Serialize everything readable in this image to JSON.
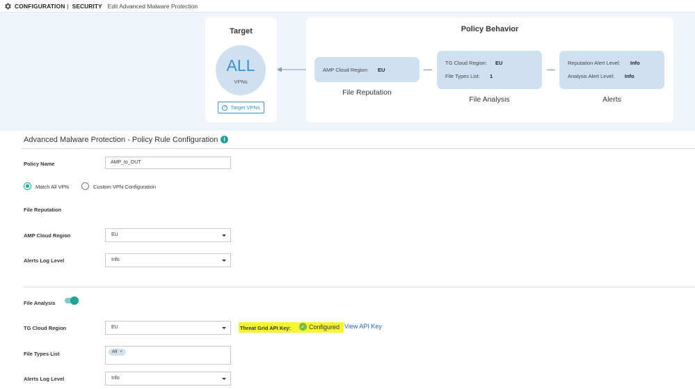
{
  "header": {
    "section": "CONFIGURATION",
    "separator": "|",
    "subsection": "SECURITY",
    "page_title": "Edit Advanced Malware Protection"
  },
  "diagram": {
    "target": {
      "title": "Target",
      "value": "ALL",
      "unit": "VPNs",
      "button_label": "Target VPNs"
    },
    "policy_behavior": {
      "title": "Policy Behavior",
      "file_reputation": {
        "label": "File Reputation",
        "fields": [
          {
            "key": "AMP Cloud Region:",
            "value": "EU"
          }
        ]
      },
      "file_analysis": {
        "label": "File Analysis",
        "fields": [
          {
            "key": "TG Cloud Region:",
            "value": "EU"
          },
          {
            "key": "File Types List:",
            "value": "1"
          }
        ]
      },
      "alerts": {
        "label": "Alerts",
        "fields": [
          {
            "key": "Reputation Alert Level:",
            "value": "Info"
          },
          {
            "key": "Analysis Alert Level:",
            "value": "Info"
          }
        ]
      }
    }
  },
  "form": {
    "title": "Advanced Malware Protection - Policy Rule Configuration",
    "policy_name_label": "Policy Name",
    "policy_name_value": "AMP_to_OUT",
    "vpn_options": [
      {
        "label": "Match All VPN",
        "selected": true
      },
      {
        "label": "Custom VPN Configuration",
        "selected": false
      }
    ],
    "file_reputation_heading": "File Reputation",
    "amp_cloud_region_label": "AMP Cloud Region",
    "amp_cloud_region_value": "EU",
    "alerts_log_level_label": "Alerts Log Level",
    "alerts_log_level_value": "Info",
    "file_analysis_label": "File Analysis",
    "file_analysis_enabled": true,
    "tg_cloud_region_label": "TG Cloud Region",
    "tg_cloud_region_value": "EU",
    "threat_grid_api_key_label": "Threat Grid API Key:",
    "threat_grid_api_key_status": "Configured",
    "view_api_key_link": "View API Key",
    "file_types_list_label": "File Types List",
    "file_types_chips": [
      "All"
    ],
    "analysis_alerts_log_level_label": "Alerts Log Level",
    "analysis_alerts_log_level_value": "Info"
  },
  "colors": {
    "accent_teal": "#1fa396",
    "link_blue": "#2a64b8",
    "diagram_bg": "#eef4fa",
    "box_blue": "#cfe1f1",
    "highlight_yellow": "#f5f530",
    "success_green": "#77b944"
  }
}
